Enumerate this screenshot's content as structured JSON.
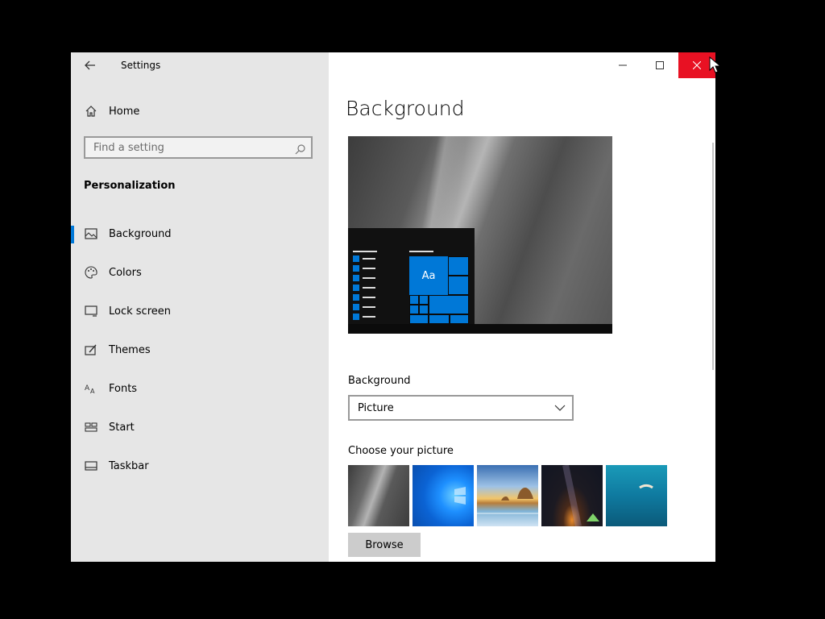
{
  "window": {
    "app_title": "Settings",
    "caption": {
      "minimize": "—",
      "maximize": "☐",
      "close": "✕"
    }
  },
  "sidebar": {
    "home_label": "Home",
    "search_placeholder": "Find a setting",
    "section_title": "Personalization",
    "items": [
      {
        "label": "Background",
        "icon": "picture-icon",
        "selected": true
      },
      {
        "label": "Colors",
        "icon": "palette-icon",
        "selected": false
      },
      {
        "label": "Lock screen",
        "icon": "lock-screen-icon",
        "selected": false
      },
      {
        "label": "Themes",
        "icon": "themes-icon",
        "selected": false
      },
      {
        "label": "Fonts",
        "icon": "fonts-icon",
        "selected": false
      },
      {
        "label": "Start",
        "icon": "start-icon",
        "selected": false
      },
      {
        "label": "Taskbar",
        "icon": "taskbar-icon",
        "selected": false
      }
    ]
  },
  "main": {
    "page_title": "Background",
    "preview": {
      "sample_text": "Aa"
    },
    "background_label": "Background",
    "background_value": "Picture",
    "choose_label": "Choose your picture",
    "browse_label": "Browse"
  },
  "colors": {
    "accent": "#0078d7",
    "close_hover": "#e81123",
    "sidebar_bg": "#e6e6e6"
  }
}
